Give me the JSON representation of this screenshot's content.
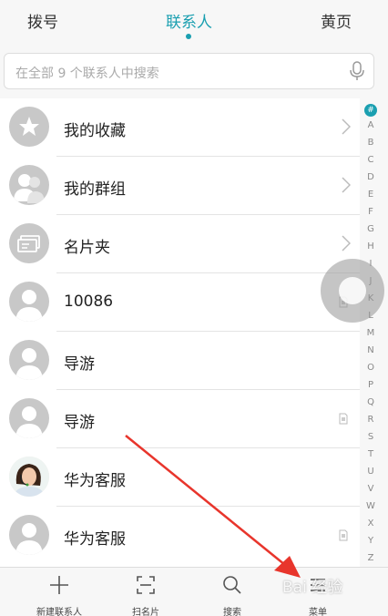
{
  "tabs": {
    "dial": "拨号",
    "contacts": "联系人",
    "yellow_pages": "黄页"
  },
  "search": {
    "placeholder": "在全部 9 个联系人中搜索"
  },
  "rows": [
    {
      "label": "我的收藏",
      "icon": "star-icon"
    },
    {
      "label": "我的群组",
      "icon": "group-icon"
    },
    {
      "label": "名片夹",
      "icon": "card-icon"
    },
    {
      "label": "10086",
      "icon": "person-icon"
    },
    {
      "label": "导游",
      "icon": "person-icon"
    },
    {
      "label": "导游",
      "icon": "person-icon"
    },
    {
      "label": "华为客服",
      "icon": "agent-photo"
    },
    {
      "label": "华为客服",
      "icon": "person-icon"
    }
  ],
  "index": [
    "#",
    "A",
    "B",
    "C",
    "D",
    "E",
    "F",
    "G",
    "H",
    "I",
    "J",
    "K",
    "L",
    "M",
    "N",
    "O",
    "P",
    "Q",
    "R",
    "S",
    "T",
    "U",
    "V",
    "W",
    "X",
    "Y",
    "Z"
  ],
  "bottom_bar": {
    "new_contact": "新建联系人",
    "scan_card": "扫名片",
    "search": "搜索",
    "menu": "菜单"
  },
  "colors": {
    "accent": "#1a9fb0",
    "arrow": "#e8352c"
  },
  "watermark": "Bai 经验"
}
